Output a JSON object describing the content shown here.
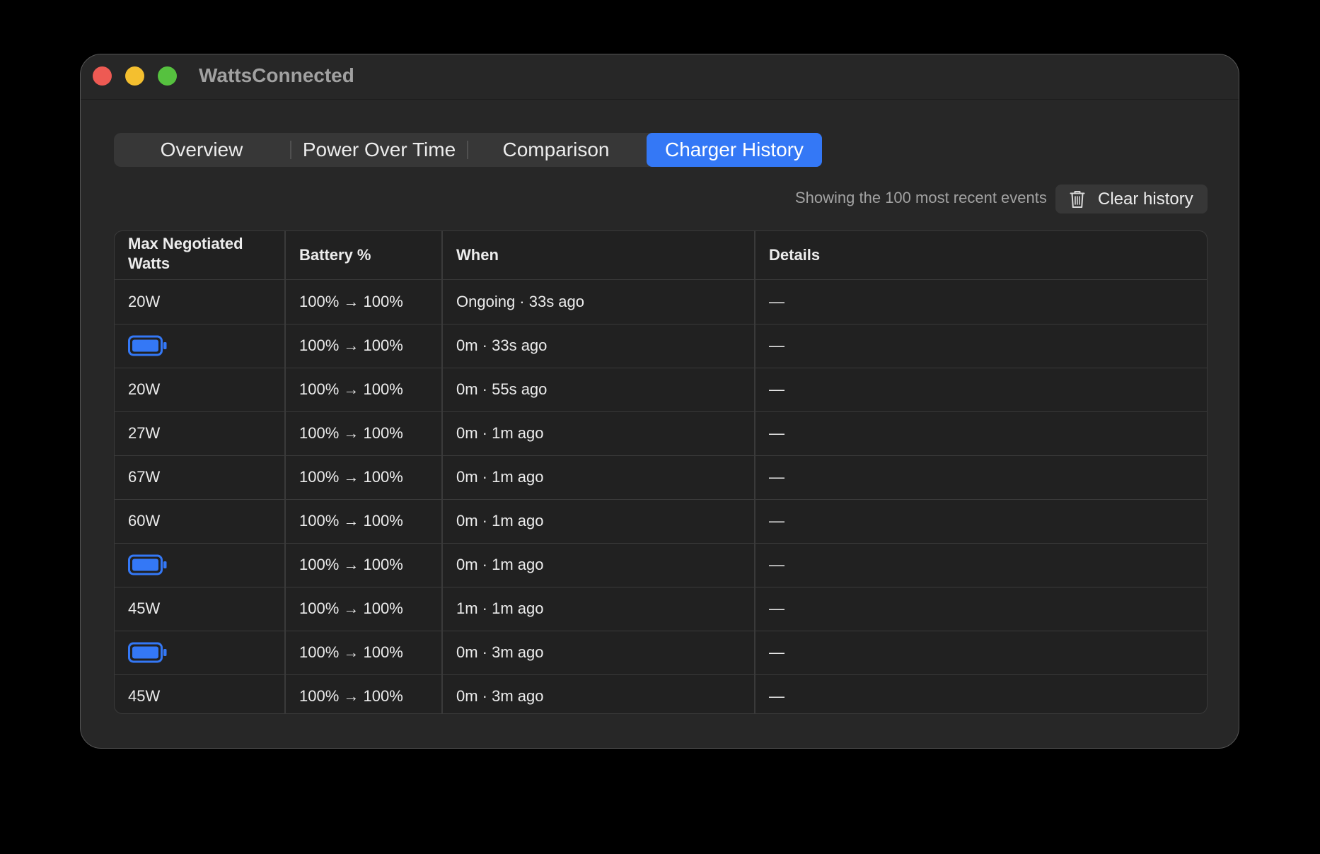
{
  "window": {
    "title": "WattsConnected"
  },
  "tabs": [
    {
      "label": "Overview",
      "active": false
    },
    {
      "label": "Power Over Time",
      "active": false
    },
    {
      "label": "Comparison",
      "active": false
    },
    {
      "label": "Charger History",
      "active": true
    }
  ],
  "toolbar": {
    "recent_note": "Showing the 100 most recent events",
    "clear_label": "Clear history",
    "clear_icon": "trash-icon"
  },
  "table": {
    "columns": [
      "Max Negotiated Watts",
      "Battery %",
      "When",
      "Details"
    ],
    "rows": [
      {
        "watts": "20W",
        "battery": "100% → 100%",
        "when": "Ongoing · 33s ago",
        "details": "—"
      },
      {
        "watts": "",
        "watts_icon": "battery-icon",
        "battery": "100% → 100%",
        "when": "0m · 33s ago",
        "details": "—"
      },
      {
        "watts": "20W",
        "battery": "100% → 100%",
        "when": "0m · 55s ago",
        "details": "—"
      },
      {
        "watts": "27W",
        "battery": "100% → 100%",
        "when": "0m · 1m ago",
        "details": "—"
      },
      {
        "watts": "67W",
        "battery": "100% → 100%",
        "when": "0m · 1m ago",
        "details": "—"
      },
      {
        "watts": "60W",
        "battery": "100% → 100%",
        "when": "0m · 1m ago",
        "details": "—"
      },
      {
        "watts": "",
        "watts_icon": "battery-icon",
        "battery": "100% → 100%",
        "when": "0m · 1m ago",
        "details": "—"
      },
      {
        "watts": "45W",
        "battery": "100% → 100%",
        "when": "1m · 1m ago",
        "details": "—"
      },
      {
        "watts": "",
        "watts_icon": "battery-icon",
        "battery": "100% → 100%",
        "when": "0m · 3m ago",
        "details": "—"
      },
      {
        "watts": "45W",
        "battery": "100% → 100%",
        "when": "0m · 3m ago",
        "details": "—"
      }
    ]
  },
  "colors": {
    "accent": "#3478f6",
    "window_bg": "#272727",
    "table_bg": "#212121"
  }
}
